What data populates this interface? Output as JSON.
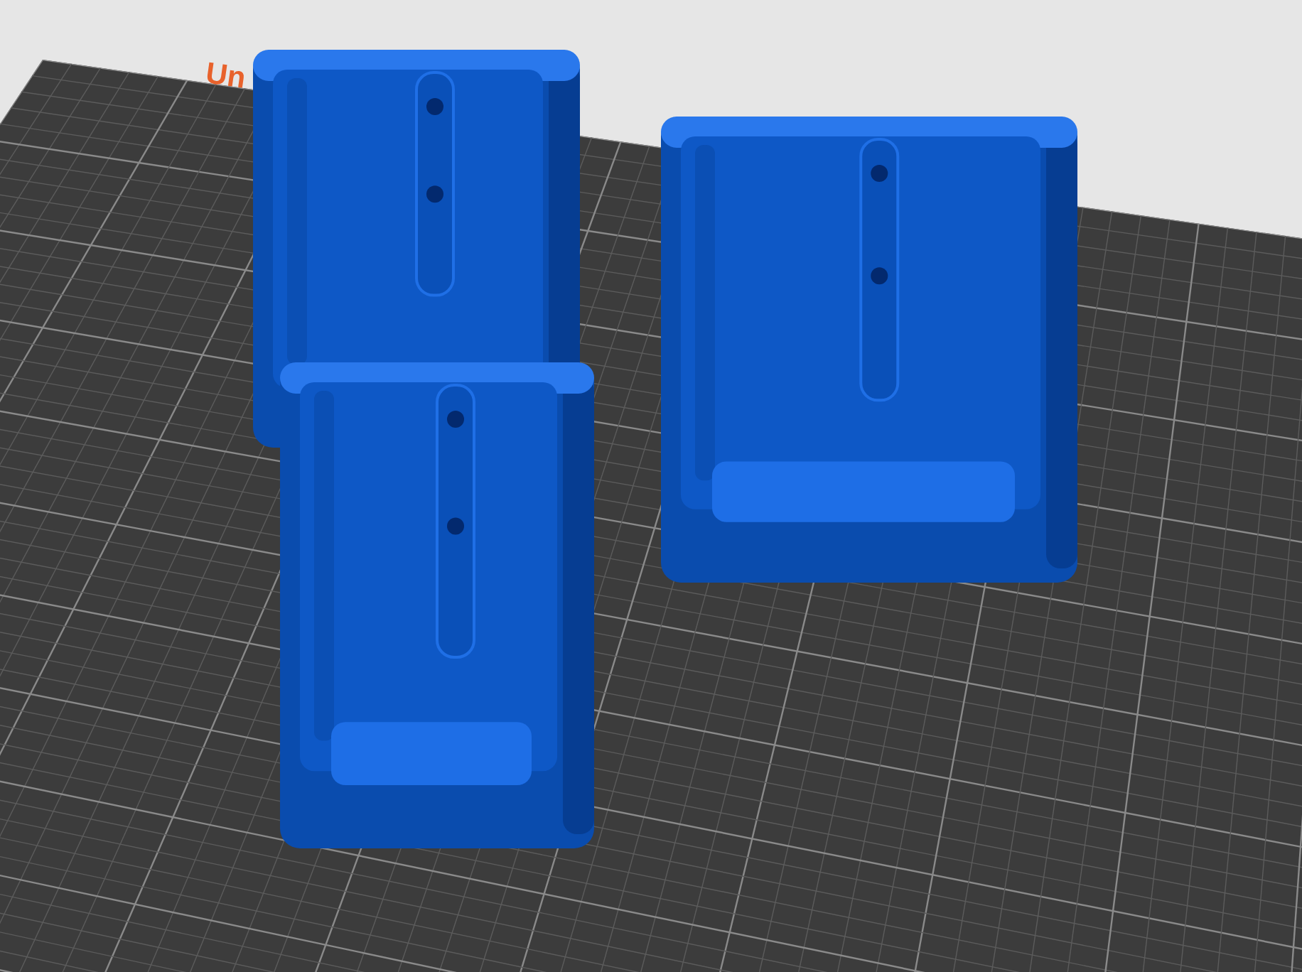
{
  "plate": {
    "label": "Un"
  }
}
